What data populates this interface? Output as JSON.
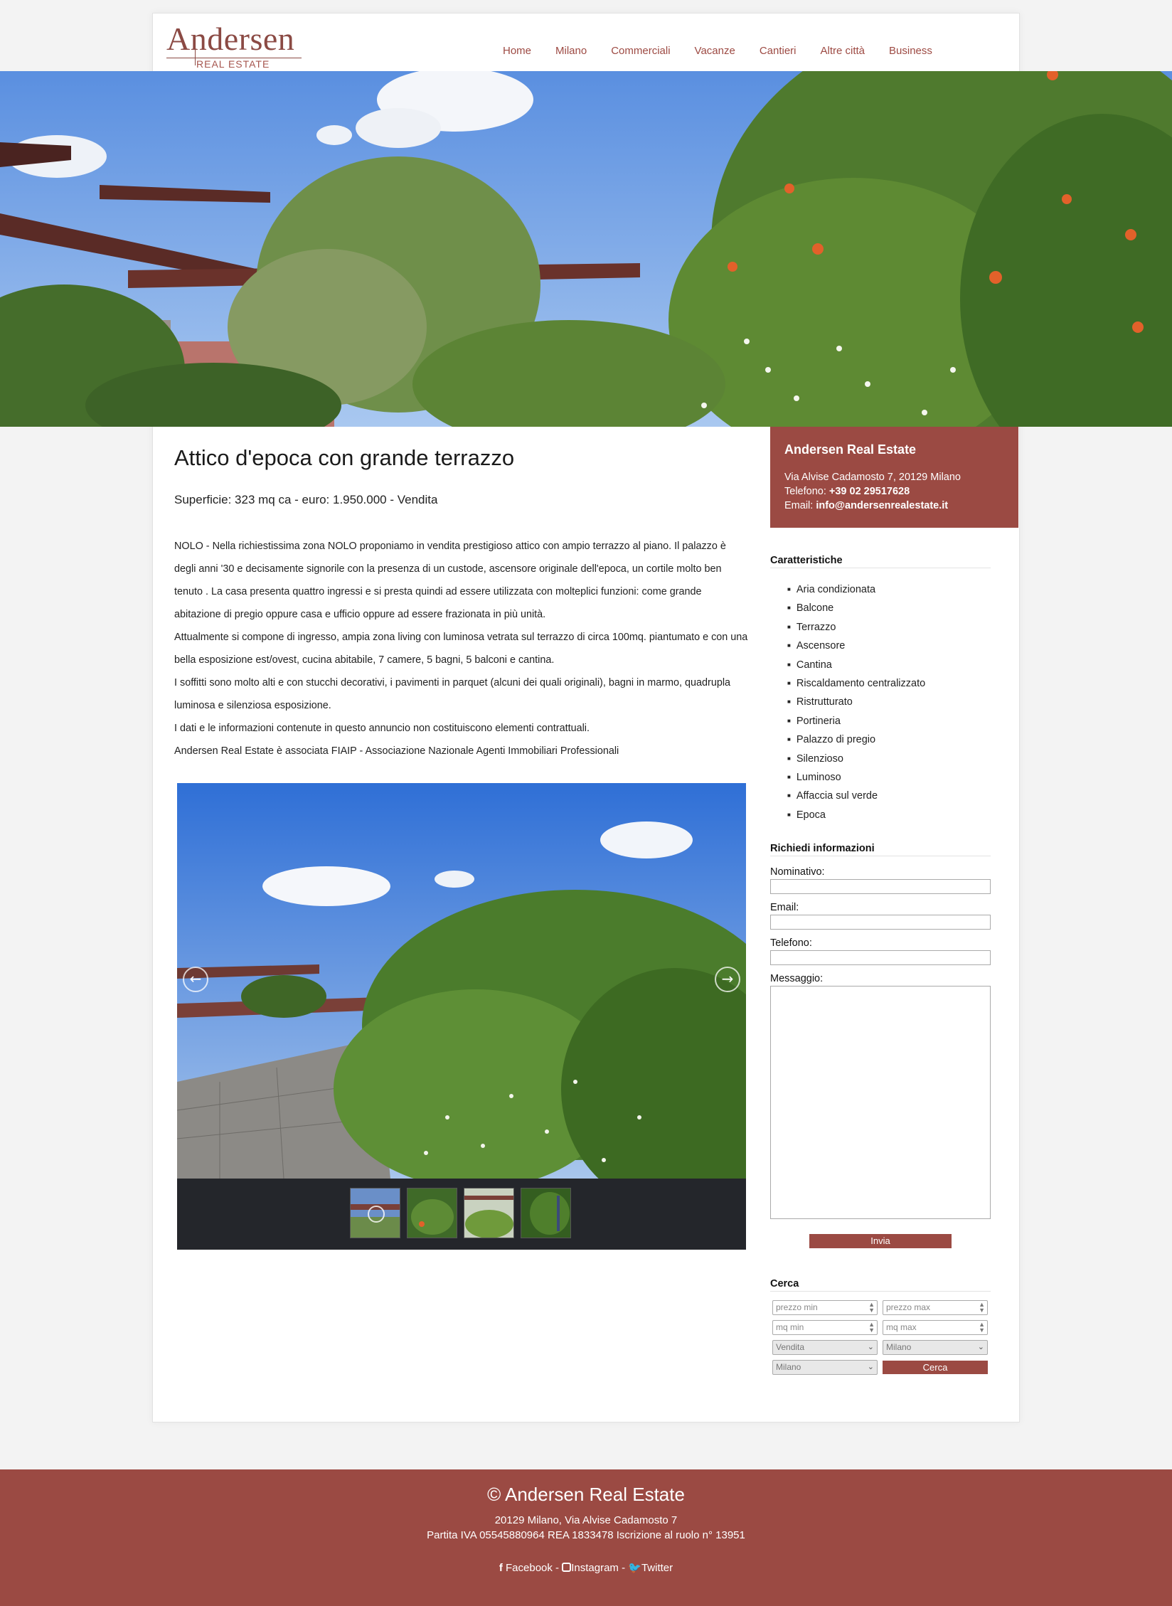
{
  "logo": {
    "name": "Andersen",
    "tagline": "REAL ESTATE"
  },
  "nav": [
    "Home",
    "Milano",
    "Commerciali",
    "Vacanze",
    "Cantieri",
    "Altre città",
    "Business"
  ],
  "listing": {
    "title": "Attico d'epoca con grande terrazzo",
    "summary": "Superficie: 323 mq ca - euro: 1.950.000 - Vendita",
    "description": [
      "NOLO - Nella richiestissima zona NOLO proponiamo in vendita prestigioso attico con ampio terrazzo al piano. Il palazzo è degli anni '30 e decisamente signorile con la presenza di un custode, ascensore originale dell'epoca, un cortile molto ben tenuto . La casa presenta quattro ingressi e si presta quindi ad essere utilizzata con molteplici funzioni: come grande abitazione di pregio oppure casa e ufficio oppure ad essere frazionata in più unità.",
      "Attualmente si compone di ingresso, ampia zona living con luminosa vetrata sul terrazzo di circa 100mq. piantumato e con una bella esposizione est/ovest, cucina abitabile, 7 camere, 5 bagni, 5 balconi e cantina.",
      "I soffitti sono molto alti e con stucchi decorativi, i pavimenti in parquet (alcuni dei quali originali), bagni in marmo, quadrupla luminosa e silenziosa esposizione.",
      "I dati e le informazioni contenute in questo annuncio non costituiscono elementi contrattuali.",
      "Andersen Real Estate è associata FIAIP - Associazione Nazionale Agenti Immobiliari Professionali"
    ]
  },
  "gallery": {
    "prev_icon": "arrow-left-icon",
    "next_icon": "arrow-right-icon",
    "thumbnail_count": 4
  },
  "agency": {
    "name": "Andersen Real Estate",
    "address": "Via Alvise Cadamosto 7, 20129 Milano",
    "phone_label": "Telefono: ",
    "phone": "+39 02 29517628",
    "email_label": "Email: ",
    "email": "info@andersenrealestate.it"
  },
  "features": {
    "title": "Caratteristiche",
    "items": [
      "Aria condizionata",
      "Balcone",
      "Terrazzo",
      "Ascensore",
      "Cantina",
      "Riscaldamento centralizzato",
      "Ristrutturato",
      "Portineria",
      "Palazzo di pregio",
      "Silenzioso",
      "Luminoso",
      "Affaccia sul verde",
      "Epoca"
    ]
  },
  "contact_form": {
    "title": "Richiedi informazioni",
    "name_label": "Nominativo:",
    "email_label": "Email:",
    "phone_label": "Telefono:",
    "message_label": "Messaggio:",
    "submit": "Invia"
  },
  "search": {
    "title": "Cerca",
    "price_min": "prezzo min",
    "price_max": "prezzo max",
    "sqm_min": "mq min",
    "sqm_max": "mq max",
    "contract": "Vendita",
    "city": "Milano",
    "zone": "Milano",
    "submit": "Cerca"
  },
  "footer": {
    "copyright": "© Andersen Real Estate",
    "address": "20129 Milano, Via Alvise Cadamosto 7",
    "legal": "Partita IVA 05545880964 REA 1833478 Iscrizione al ruolo n° 13951",
    "facebook": "Facebook",
    "instagram": "Instagram",
    "twitter": "Twitter",
    "separator": " - "
  },
  "colors": {
    "brand": "#9b4a43",
    "nav_text": "#9d4a43",
    "gallery_bg": "#24262b"
  }
}
